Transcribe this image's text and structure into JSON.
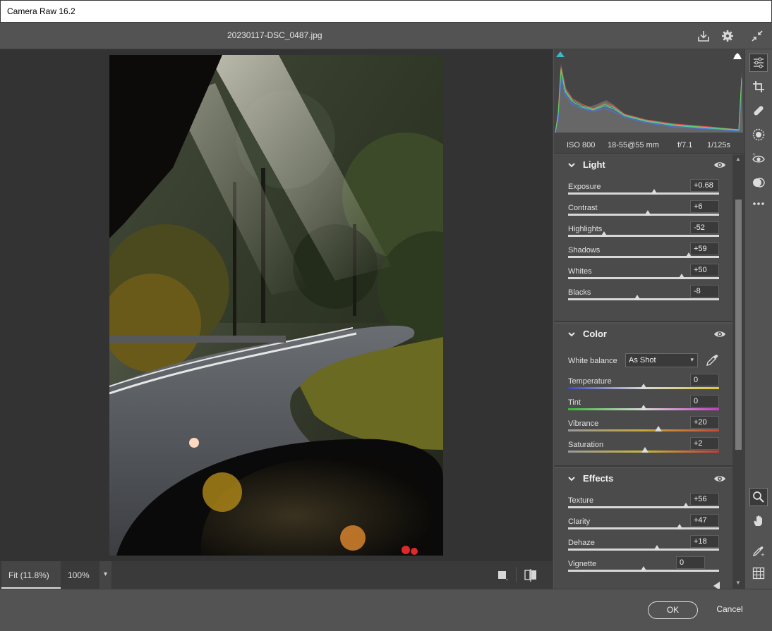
{
  "window": {
    "title": "Camera Raw 16.2"
  },
  "header": {
    "filename": "20230117-DSC_0487.jpg"
  },
  "canvas": {
    "zoom_fit": "Fit (11.8%)",
    "zoom_100": "100%"
  },
  "histogram": {
    "iso": "ISO 800",
    "lens": "18-55@55 mm",
    "aperture": "f/7.1",
    "shutter": "1/125s"
  },
  "light": {
    "title": "Light",
    "sliders": [
      {
        "label": "Exposure",
        "value": "+0.68",
        "pos": 0.57
      },
      {
        "label": "Contrast",
        "value": "+6",
        "pos": 0.53
      },
      {
        "label": "Highlights",
        "value": "-52",
        "pos": 0.24
      },
      {
        "label": "Shadows",
        "value": "+59",
        "pos": 0.8
      },
      {
        "label": "Whites",
        "value": "+50",
        "pos": 0.75
      },
      {
        "label": "Blacks",
        "value": "-8",
        "pos": 0.46
      }
    ]
  },
  "color": {
    "title": "Color",
    "wb_label": "White balance",
    "wb_value": "As Shot",
    "sliders": [
      {
        "label": "Temperature",
        "value": "0",
        "pos": 0.5
      },
      {
        "label": "Tint",
        "value": "0",
        "pos": 0.5
      },
      {
        "label": "Vibrance",
        "value": "+20",
        "pos": 0.6
      },
      {
        "label": "Saturation",
        "value": "+2",
        "pos": 0.51
      }
    ]
  },
  "effects": {
    "title": "Effects",
    "sliders": [
      {
        "label": "Texture",
        "value": "+56",
        "pos": 0.78
      },
      {
        "label": "Clarity",
        "value": "+47",
        "pos": 0.74
      },
      {
        "label": "Dehaze",
        "value": "+18",
        "pos": 0.59
      },
      {
        "label": "Vignette",
        "value": "0",
        "pos": 0.5
      }
    ]
  },
  "footer": {
    "ok": "OK",
    "cancel": "Cancel"
  },
  "colors": {
    "accent_teal": "#3fb7c9",
    "panel_bg": "#4b4b4b",
    "value_bg": "#3a3a3a"
  }
}
